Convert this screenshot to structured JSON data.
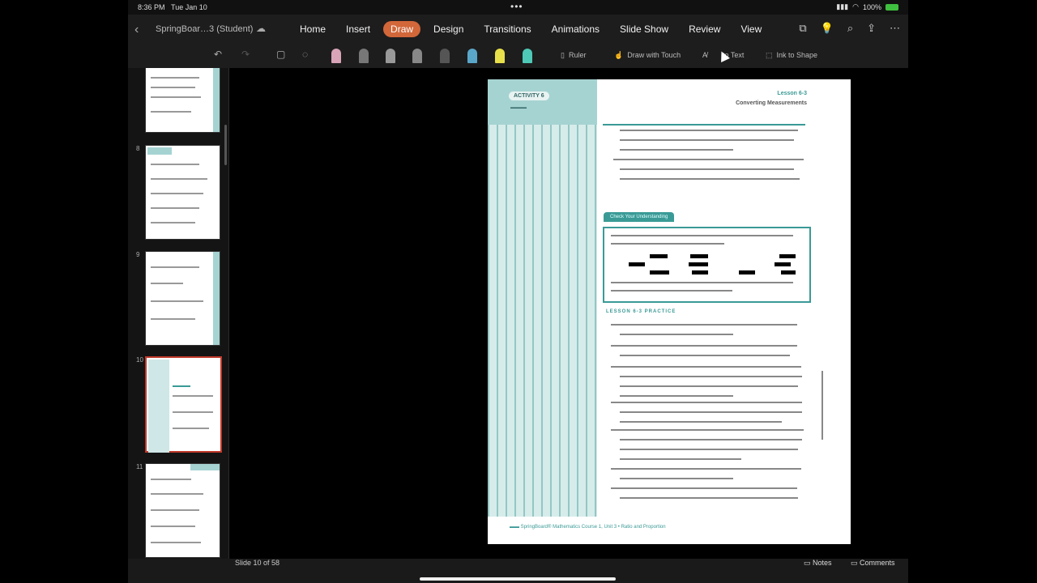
{
  "status": {
    "time": "8:36 PM",
    "date": "Tue Jan 10",
    "battery": "100%"
  },
  "document": {
    "title": "SpringBoar…3 (Student)"
  },
  "ribbon": {
    "tabs": [
      "Home",
      "Insert",
      "Draw",
      "Design",
      "Transitions",
      "Animations",
      "Slide Show",
      "Review",
      "View"
    ],
    "active_tab": "Draw",
    "accent_color": "#d2673a"
  },
  "draw_tools": {
    "ruler": "Ruler",
    "draw_with_touch": "Draw with Touch",
    "ink_to_text": "to Text",
    "ink_to_shape": "Ink to Shape"
  },
  "sidebar": {
    "slides": [
      {
        "number": ""
      },
      {
        "number": "8"
      },
      {
        "number": "9"
      },
      {
        "number": "10"
      },
      {
        "number": "11"
      }
    ],
    "selected_slide": "10"
  },
  "slide": {
    "activity_badge": "ACTIVITY 6",
    "lesson_title": "Lesson 6-3",
    "lesson_subtitle": "Converting Measurements",
    "check_box_title": "Check Your Understanding",
    "practice_heading": "LESSON 6-3 PRACTICE"
  },
  "footer": {
    "slide_count": "Slide 10 of 58",
    "notes": "Notes",
    "comments": "Comments"
  }
}
